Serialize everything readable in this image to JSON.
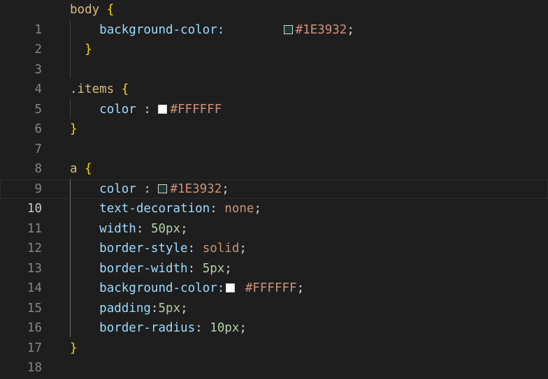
{
  "editor": {
    "current_line": 10,
    "colors": {
      "dark_swatch": "#1E3932",
      "light_swatch": "#FFFFFF"
    },
    "lines": [
      {
        "num": "1",
        "t": [
          "body",
          "{"
        ]
      },
      {
        "num": "2",
        "t": [
          "background-color:",
          "#1E3932",
          ";"
        ]
      },
      {
        "num": "3",
        "t": [
          "}"
        ]
      },
      {
        "num": "4",
        "t": []
      },
      {
        "num": "5",
        "t": [
          ".items",
          "{"
        ]
      },
      {
        "num": "6",
        "t": [
          "color",
          ":",
          "#FFFFFF"
        ]
      },
      {
        "num": "7",
        "t": [
          "}"
        ]
      },
      {
        "num": "8",
        "t": []
      },
      {
        "num": "9",
        "t": [
          "a",
          "{"
        ]
      },
      {
        "num": "10",
        "t": [
          "color",
          ":",
          "#1E3932",
          ";"
        ]
      },
      {
        "num": "11",
        "t": [
          "text-decoration",
          ":",
          "none",
          ";"
        ]
      },
      {
        "num": "12",
        "t": [
          "width",
          ":",
          "50px",
          ";"
        ]
      },
      {
        "num": "13",
        "t": [
          "border-style",
          ":",
          "solid",
          ";"
        ]
      },
      {
        "num": "14",
        "t": [
          "border-width",
          ":",
          "5px",
          ";"
        ]
      },
      {
        "num": "15",
        "t": [
          "background-color:",
          "#FFFFFF",
          ";"
        ]
      },
      {
        "num": "16",
        "t": [
          "padding",
          ":",
          "5px",
          ";"
        ]
      },
      {
        "num": "17",
        "t": [
          "border-radius",
          ":",
          "10px",
          ";"
        ]
      },
      {
        "num": "18",
        "t": [
          "}"
        ]
      }
    ]
  }
}
